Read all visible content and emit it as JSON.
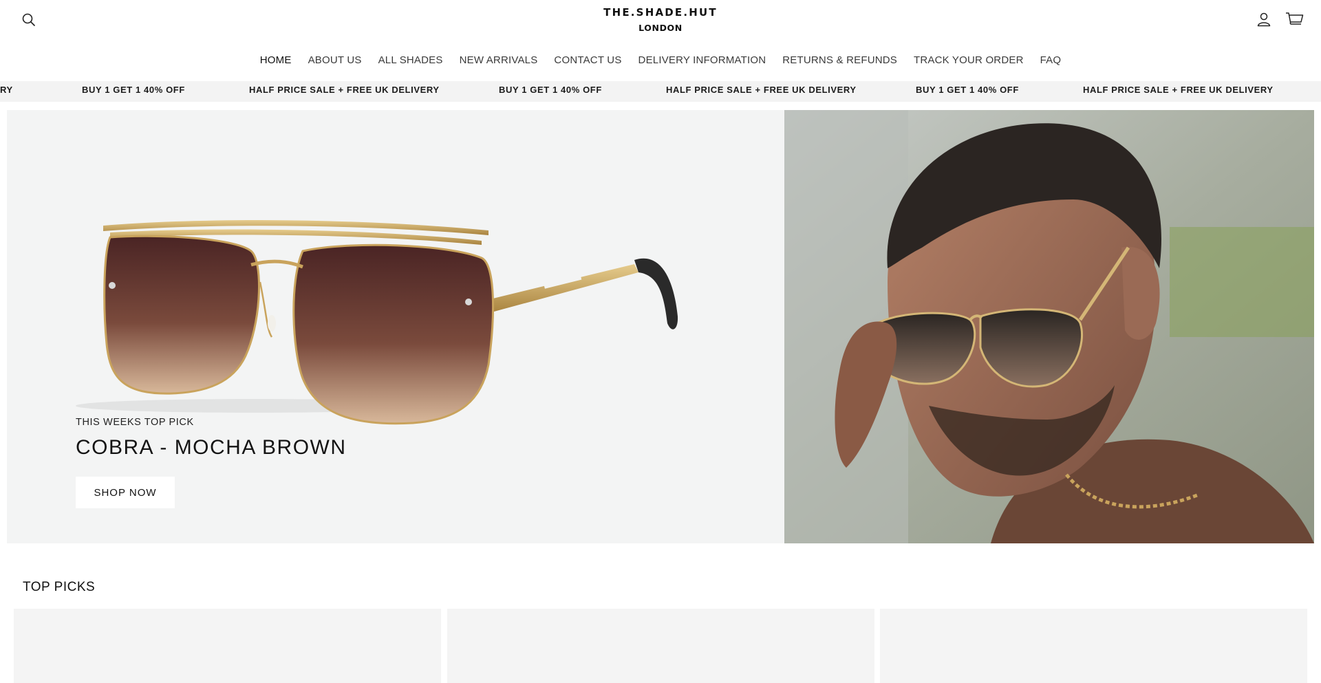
{
  "header": {
    "logo_main": "THE.SHADE.HUT",
    "logo_sub": "LONDON",
    "icons": {
      "search": "search-icon",
      "account": "account-icon",
      "cart": "cart-icon"
    }
  },
  "nav": {
    "items": [
      {
        "label": "HOME",
        "active": true
      },
      {
        "label": "ABOUT US"
      },
      {
        "label": "ALL SHADES"
      },
      {
        "label": "NEW ARRIVALS"
      },
      {
        "label": "CONTACT US"
      },
      {
        "label": "DELIVERY INFORMATION"
      },
      {
        "label": "RETURNS & REFUNDS"
      },
      {
        "label": "TRACK YOUR ORDER"
      },
      {
        "label": "FAQ"
      }
    ]
  },
  "announcement": {
    "items": [
      "RY",
      "BUY 1 GET 1 40% OFF",
      "HALF PRICE SALE + FREE UK DELIVERY",
      "BUY 1 GET 1 40% OFF",
      "HALF PRICE SALE + FREE UK DELIVERY",
      "BUY 1 GET 1 40% OFF",
      "HALF PRICE SALE + FREE UK DELIVERY"
    ]
  },
  "hero": {
    "subtitle": "THIS WEEKS TOP PICK",
    "title": "COBRA - MOCHA BROWN",
    "button_label": "SHOP NOW"
  },
  "top_picks": {
    "title": "TOP PICKS"
  },
  "colors": {
    "announcement_bg": "#f3f3f3",
    "hero_bg": "#f3f4f4",
    "card_bg": "#f4f4f4",
    "lens_brown": "#5a2d2a",
    "frame_gold": "#c9a35c"
  }
}
